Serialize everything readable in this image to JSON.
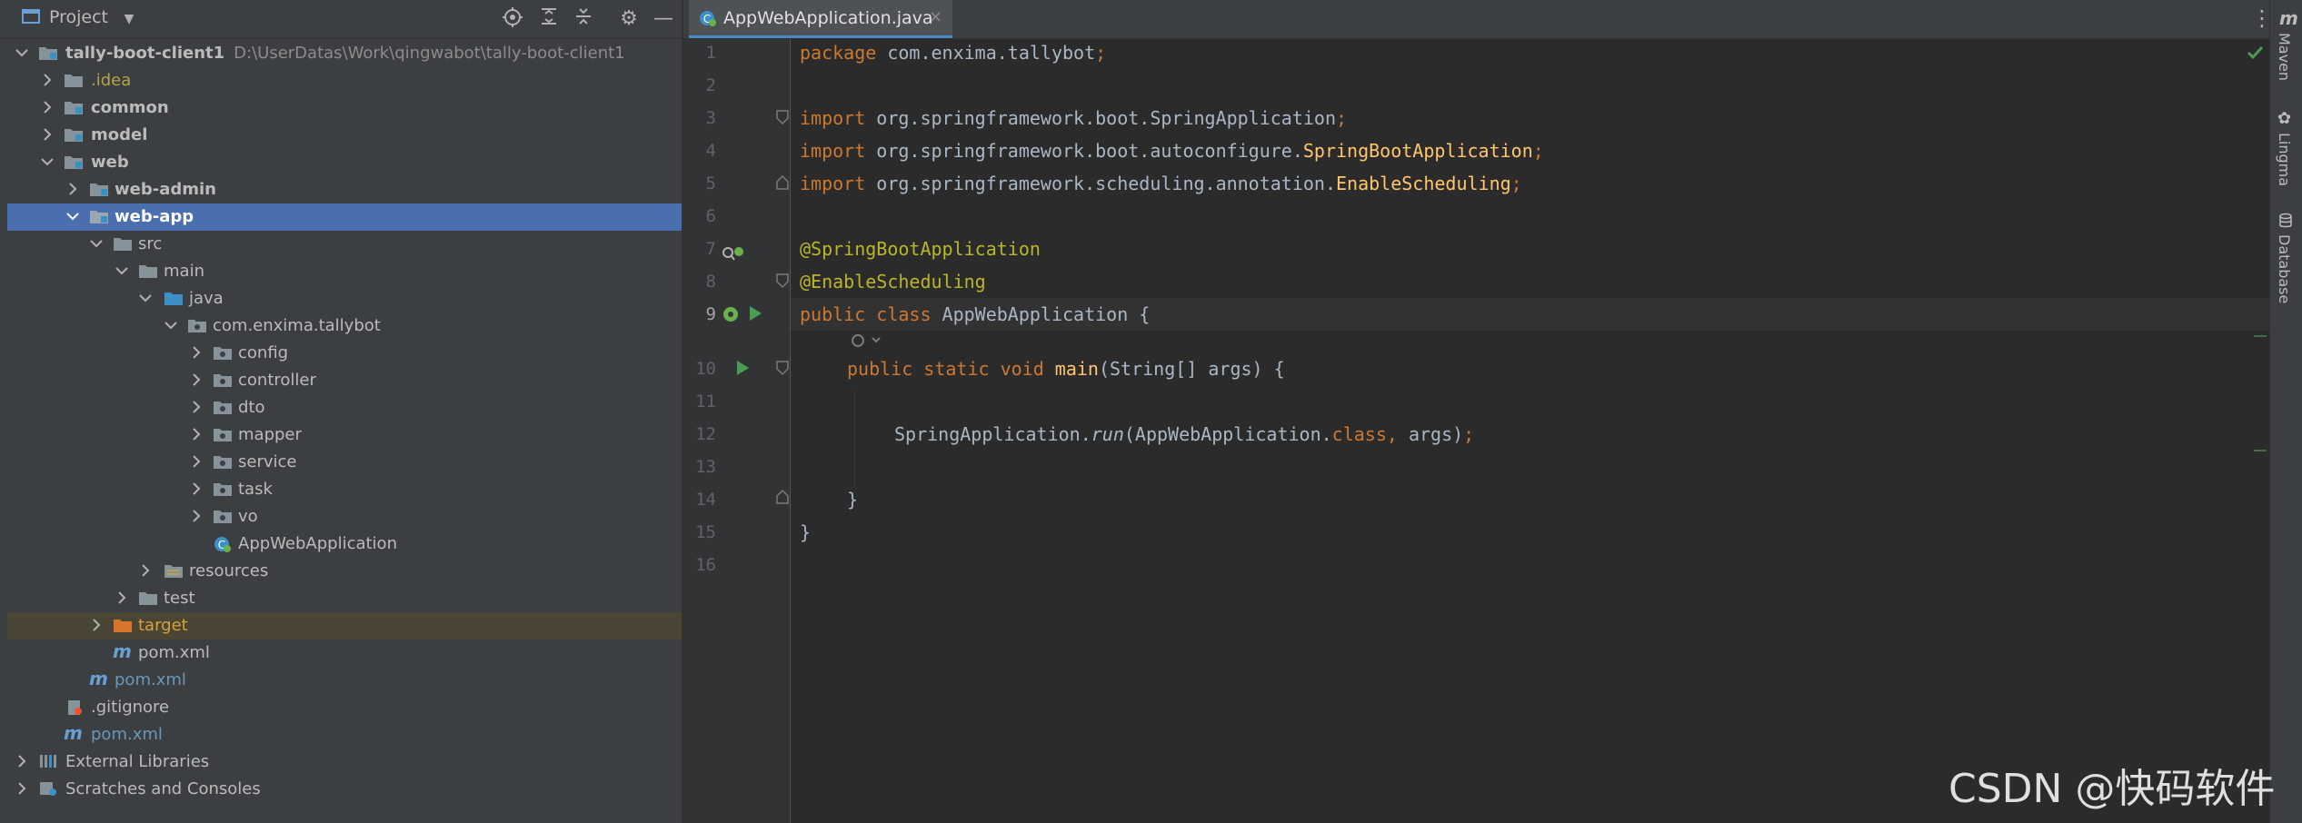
{
  "project_panel": {
    "title": "Project",
    "tree": [
      {
        "label": "tally-boot-client1",
        "path": "D:\\UserDatas\\Work\\qingwabot\\tally-boot-client1"
      },
      {
        "label": ".idea"
      },
      {
        "label": "common"
      },
      {
        "label": "model"
      },
      {
        "label": "web"
      },
      {
        "label": "web-admin"
      },
      {
        "label": "web-app"
      },
      {
        "label": "src"
      },
      {
        "label": "main"
      },
      {
        "label": "java"
      },
      {
        "label": "com.enxima.tallybot"
      },
      {
        "label": "config"
      },
      {
        "label": "controller"
      },
      {
        "label": "dto"
      },
      {
        "label": "mapper"
      },
      {
        "label": "service"
      },
      {
        "label": "task"
      },
      {
        "label": "vo"
      },
      {
        "label": "AppWebApplication"
      },
      {
        "label": "resources"
      },
      {
        "label": "test"
      },
      {
        "label": "target"
      },
      {
        "label": "pom.xml"
      },
      {
        "label": "pom.xml"
      },
      {
        "label": ".gitignore"
      },
      {
        "label": "pom.xml"
      },
      {
        "label": "External Libraries"
      },
      {
        "label": "Scratches and Consoles"
      }
    ]
  },
  "editor": {
    "tab_label": "AppWebApplication.java",
    "tab_close": "×",
    "line_numbers": [
      "1",
      "2",
      "3",
      "4",
      "5",
      "6",
      "7",
      "8",
      "9",
      "10",
      "11",
      "12",
      "13",
      "14",
      "15",
      "16"
    ],
    "code": {
      "l1_kw": "package",
      "l1_pkg": " com.enxima.tallybot",
      "l1_semi": ";",
      "import_kw": "import",
      "l3_a": " org.springframework.boot.SpringApplication",
      "l4_a": " org.springframework.boot.autoconfigure.",
      "l4_b": "SpringBootApplication",
      "l5_a": " org.springframework.scheduling.annotation.",
      "l5_b": "EnableScheduling",
      "semi": ";",
      "l7": "@SpringBootApplication",
      "l8": "@EnableScheduling",
      "l9_kw": "public class",
      "l9_name": " AppWebApplication {",
      "l10_kw": "public static void",
      "l10_fn": "main",
      "l10_rest": "(String[] args) {",
      "l12_a": "SpringApplication.",
      "l12_run": "run",
      "l12_b": "(AppWebApplication.",
      "l12_class": "class,",
      "l12_c": " args)",
      "l12_semi": ";",
      "l14": "}",
      "l15": "}"
    }
  },
  "right_toolbar": {
    "m_label": "m",
    "items": [
      "Maven",
      "Lingma",
      "Database"
    ]
  },
  "watermark": "CSDN @快码软件",
  "colors": {
    "selection": "#4b6eaf",
    "keyword": "#cc7832",
    "annotation": "#bbb529",
    "method": "#ffc66d",
    "text": "#a9b7c6"
  }
}
